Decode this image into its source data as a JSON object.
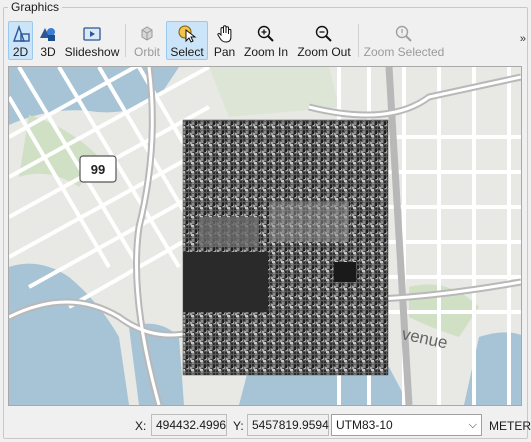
{
  "panel": {
    "title": "Graphics"
  },
  "toolbar": {
    "items": [
      {
        "label": "2D",
        "icon": "2d-view-icon",
        "active": true,
        "disabled": false
      },
      {
        "label": "3D",
        "icon": "3d-view-icon",
        "active": false,
        "disabled": false
      },
      {
        "label": "Slideshow",
        "icon": "slideshow-icon",
        "active": false,
        "disabled": false
      },
      {
        "label": "Orbit",
        "icon": "orbit-icon",
        "active": false,
        "disabled": true
      },
      {
        "label": "Select",
        "icon": "select-icon",
        "active": true,
        "disabled": false
      },
      {
        "label": "Pan",
        "icon": "pan-hand-icon",
        "active": false,
        "disabled": false
      },
      {
        "label": "Zoom In",
        "icon": "zoom-in-icon",
        "active": false,
        "disabled": false
      },
      {
        "label": "Zoom Out",
        "icon": "zoom-out-icon",
        "active": false,
        "disabled": false
      },
      {
        "label": "Zoom Selected",
        "icon": "zoom-selected-icon",
        "active": false,
        "disabled": true
      }
    ],
    "overflow_label": "»"
  },
  "map": {
    "highway_shield": "99",
    "street_label": "venue"
  },
  "status": {
    "x_label": "X:",
    "x_value": "494432.4996",
    "y_label": "Y:",
    "y_value": "5457819.9594",
    "projection": "UTM83-10",
    "units": "METER"
  },
  "colors": {
    "active_button_bg": "#cce4f7",
    "water": "#a6c4d6",
    "park": "#cfe0c4",
    "road": "#ffffff"
  }
}
